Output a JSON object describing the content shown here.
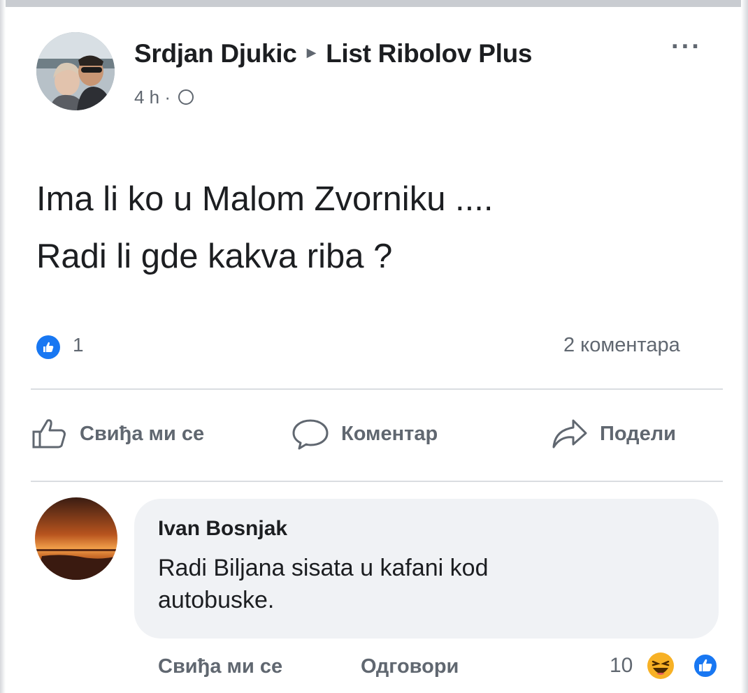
{
  "post": {
    "author": "Srdjan Djukic",
    "group": "List Ribolov Plus",
    "time": "4 h ·",
    "more_label": "···",
    "text_line1": "Ima li ko u Malom Zvorniku ....",
    "text_line2": "Radi li gde kakva riba ?",
    "like_count": "1",
    "comment_count": "2 коментара"
  },
  "actions": {
    "like": "Свиђа ми се",
    "comment": "Коментар",
    "share": "Подели"
  },
  "comment": {
    "author": "Ivan Bosnjak",
    "text_line1": "Radi Biljana sisata u kafani kod",
    "text_line2": "autobuske.",
    "like_label": "Свиђа ми се",
    "reply_label": "Одговори",
    "reaction_count": "10"
  },
  "icons": {
    "like_reaction": "thumbs-up-icon",
    "haha_reaction": "laughing-face-icon",
    "comment": "speech-bubble-icon",
    "share": "share-arrow-icon",
    "audience": "globe-icon"
  },
  "colors": {
    "facebook_blue": "#1877f2",
    "haha_yellow": "#f7b125",
    "secondary_text": "#606770",
    "bubble_bg": "#f0f2f5"
  }
}
